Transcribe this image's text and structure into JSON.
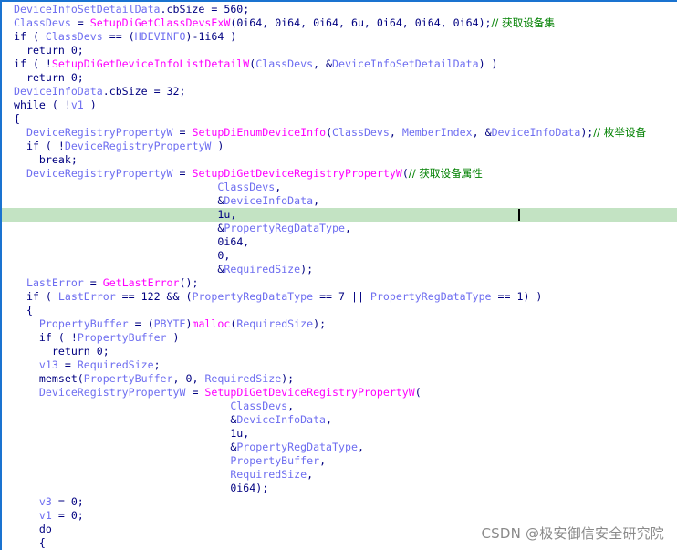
{
  "editor": {
    "highlight_color": "#c3e3c3",
    "border_color": "#1a73d0",
    "colors": {
      "variable": "#6e6ef0",
      "function": "#ff00ff",
      "keyword": "#000080",
      "comment": "#008000"
    },
    "highlighted_line_index": 15,
    "lines": [
      {
        "indent": "",
        "tokens": [
          [
            "var",
            "DeviceInfoSetDetailData"
          ],
          [
            "def",
            ".cbSize = 560;"
          ]
        ]
      },
      {
        "indent": "",
        "tokens": [
          [
            "var",
            "ClassDevs"
          ],
          [
            "def",
            " = "
          ],
          [
            "fn",
            "SetupDiGetClassDevsExW"
          ],
          [
            "def",
            "(0i64, 0i64, 0i64, 6u, 0i64, 0i64, 0i64);"
          ],
          [
            "cm",
            "// 获取设备集"
          ]
        ]
      },
      {
        "indent": "",
        "tokens": [
          [
            "def",
            "if ( "
          ],
          [
            "var",
            "ClassDevs"
          ],
          [
            "def",
            " == ("
          ],
          [
            "var",
            "HDEVINFO"
          ],
          [
            "def",
            ")-1i64 )"
          ]
        ]
      },
      {
        "indent": "  ",
        "tokens": [
          [
            "def",
            "return 0;"
          ]
        ]
      },
      {
        "indent": "",
        "tokens": [
          [
            "def",
            "if ( !"
          ],
          [
            "fn",
            "SetupDiGetDeviceInfoListDetailW"
          ],
          [
            "def",
            "("
          ],
          [
            "var",
            "ClassDevs"
          ],
          [
            "def",
            ", &"
          ],
          [
            "var",
            "DeviceInfoSetDetailData"
          ],
          [
            "def",
            ") )"
          ]
        ]
      },
      {
        "indent": "  ",
        "tokens": [
          [
            "def",
            "return 0;"
          ]
        ]
      },
      {
        "indent": "",
        "tokens": [
          [
            "var",
            "DeviceInfoData"
          ],
          [
            "def",
            ".cbSize = 32;"
          ]
        ]
      },
      {
        "indent": "",
        "tokens": [
          [
            "def",
            "while ( !"
          ],
          [
            "var",
            "v1"
          ],
          [
            "def",
            " )"
          ]
        ]
      },
      {
        "indent": "",
        "tokens": [
          [
            "def",
            "{"
          ]
        ]
      },
      {
        "indent": "  ",
        "tokens": [
          [
            "var",
            "DeviceRegistryPropertyW"
          ],
          [
            "def",
            " = "
          ],
          [
            "fn",
            "SetupDiEnumDeviceInfo"
          ],
          [
            "def",
            "("
          ],
          [
            "var",
            "ClassDevs"
          ],
          [
            "def",
            ", "
          ],
          [
            "var",
            "MemberIndex"
          ],
          [
            "def",
            ", &"
          ],
          [
            "var",
            "DeviceInfoData"
          ],
          [
            "def",
            ");"
          ],
          [
            "cm",
            "// 枚举设备"
          ]
        ]
      },
      {
        "indent": "  ",
        "tokens": [
          [
            "def",
            "if ( !"
          ],
          [
            "var",
            "DeviceRegistryPropertyW"
          ],
          [
            "def",
            " )"
          ]
        ]
      },
      {
        "indent": "    ",
        "tokens": [
          [
            "def",
            "break;"
          ]
        ]
      },
      {
        "indent": "  ",
        "tokens": [
          [
            "var",
            "DeviceRegistryPropertyW"
          ],
          [
            "def",
            " = "
          ],
          [
            "fn",
            "SetupDiGetDeviceRegistryPropertyW"
          ],
          [
            "def",
            "("
          ],
          [
            "cm",
            "// 获取设备属性"
          ]
        ]
      },
      {
        "indent": "                                ",
        "tokens": [
          [
            "var",
            "ClassDevs"
          ],
          [
            "def",
            ","
          ]
        ]
      },
      {
        "indent": "                                ",
        "tokens": [
          [
            "def",
            "&"
          ],
          [
            "var",
            "DeviceInfoData"
          ],
          [
            "def",
            ","
          ]
        ]
      },
      {
        "indent": "                                ",
        "tokens": [
          [
            "def",
            "1u,"
          ]
        ]
      },
      {
        "indent": "                                ",
        "tokens": [
          [
            "def",
            "&"
          ],
          [
            "var",
            "PropertyRegDataType"
          ],
          [
            "def",
            ","
          ]
        ]
      },
      {
        "indent": "                                ",
        "tokens": [
          [
            "def",
            "0i64,"
          ]
        ]
      },
      {
        "indent": "                                ",
        "tokens": [
          [
            "def",
            "0,"
          ]
        ]
      },
      {
        "indent": "                                ",
        "tokens": [
          [
            "def",
            "&"
          ],
          [
            "var",
            "RequiredSize"
          ],
          [
            "def",
            ");"
          ]
        ]
      },
      {
        "indent": "  ",
        "tokens": [
          [
            "var",
            "LastError"
          ],
          [
            "def",
            " = "
          ],
          [
            "fn",
            "GetLastError"
          ],
          [
            "def",
            "();"
          ]
        ]
      },
      {
        "indent": "  ",
        "tokens": [
          [
            "def",
            "if ( "
          ],
          [
            "var",
            "LastError"
          ],
          [
            "def",
            " == 122 && ("
          ],
          [
            "var",
            "PropertyRegDataType"
          ],
          [
            "def",
            " == 7 || "
          ],
          [
            "var",
            "PropertyRegDataType"
          ],
          [
            "def",
            " == 1) )"
          ]
        ]
      },
      {
        "indent": "  ",
        "tokens": [
          [
            "def",
            "{"
          ]
        ]
      },
      {
        "indent": "    ",
        "tokens": [
          [
            "var",
            "PropertyBuffer"
          ],
          [
            "def",
            " = ("
          ],
          [
            "var",
            "PBYTE"
          ],
          [
            "def",
            ")"
          ],
          [
            "fn",
            "malloc"
          ],
          [
            "def",
            "("
          ],
          [
            "var",
            "RequiredSize"
          ],
          [
            "def",
            ");"
          ]
        ]
      },
      {
        "indent": "    ",
        "tokens": [
          [
            "def",
            "if ( !"
          ],
          [
            "var",
            "PropertyBuffer"
          ],
          [
            "def",
            " )"
          ]
        ]
      },
      {
        "indent": "      ",
        "tokens": [
          [
            "def",
            "return 0;"
          ]
        ]
      },
      {
        "indent": "    ",
        "tokens": [
          [
            "var",
            "v13"
          ],
          [
            "def",
            " = "
          ],
          [
            "var",
            "RequiredSize"
          ],
          [
            "def",
            ";"
          ]
        ]
      },
      {
        "indent": "    ",
        "tokens": [
          [
            "def",
            "memset("
          ],
          [
            "var",
            "PropertyBuffer"
          ],
          [
            "def",
            ", 0, "
          ],
          [
            "var",
            "RequiredSize"
          ],
          [
            "def",
            ");"
          ]
        ]
      },
      {
        "indent": "    ",
        "tokens": [
          [
            "var",
            "DeviceRegistryPropertyW"
          ],
          [
            "def",
            " = "
          ],
          [
            "fn",
            "SetupDiGetDeviceRegistryPropertyW"
          ],
          [
            "def",
            "("
          ]
        ]
      },
      {
        "indent": "                                  ",
        "tokens": [
          [
            "var",
            "ClassDevs"
          ],
          [
            "def",
            ","
          ]
        ]
      },
      {
        "indent": "                                  ",
        "tokens": [
          [
            "def",
            "&"
          ],
          [
            "var",
            "DeviceInfoData"
          ],
          [
            "def",
            ","
          ]
        ]
      },
      {
        "indent": "                                  ",
        "tokens": [
          [
            "def",
            "1u,"
          ]
        ]
      },
      {
        "indent": "                                  ",
        "tokens": [
          [
            "def",
            "&"
          ],
          [
            "var",
            "PropertyRegDataType"
          ],
          [
            "def",
            ","
          ]
        ]
      },
      {
        "indent": "                                  ",
        "tokens": [
          [
            "var",
            "PropertyBuffer"
          ],
          [
            "def",
            ","
          ]
        ]
      },
      {
        "indent": "                                  ",
        "tokens": [
          [
            "var",
            "RequiredSize"
          ],
          [
            "def",
            ","
          ]
        ]
      },
      {
        "indent": "                                  ",
        "tokens": [
          [
            "def",
            "0i64);"
          ]
        ]
      },
      {
        "indent": "    ",
        "tokens": [
          [
            "var",
            "v3"
          ],
          [
            "def",
            " = 0;"
          ]
        ]
      },
      {
        "indent": "    ",
        "tokens": [
          [
            "var",
            "v1"
          ],
          [
            "def",
            " = 0;"
          ]
        ]
      },
      {
        "indent": "    ",
        "tokens": [
          [
            "def",
            "do"
          ]
        ]
      },
      {
        "indent": "    ",
        "tokens": [
          [
            "def",
            "{"
          ]
        ]
      }
    ]
  },
  "watermark": "CSDN @极安御信安全研究院"
}
